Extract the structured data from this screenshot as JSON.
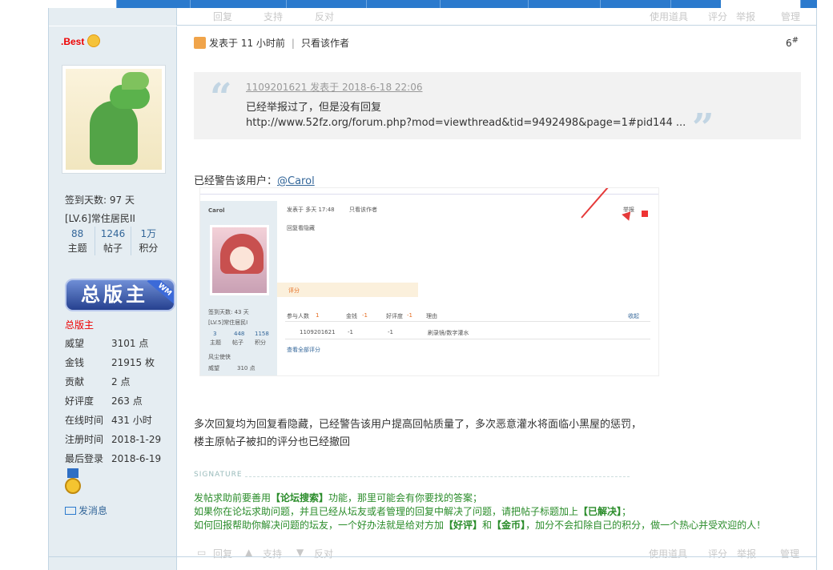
{
  "prev_actions": {
    "reply": "回复",
    "support": "支持",
    "oppose": "反对",
    "use_tool": "使用道具",
    "rate": "评分",
    "report": "举报",
    "manage": "管理"
  },
  "author": {
    "name": ".Best",
    "checkin_days": "签到天数: 97 天",
    "level": "[LV.6]常住居民II",
    "stats": [
      {
        "value": "88",
        "label": "主题"
      },
      {
        "value": "1246",
        "label": "帖子"
      },
      {
        "value": "1万",
        "label": "积分"
      }
    ],
    "badge_text": "总版主",
    "badge_tag": "WM",
    "group": "总版主",
    "details": [
      {
        "key": "威望",
        "value": "3101 点"
      },
      {
        "key": "金钱",
        "value": "21915 枚"
      },
      {
        "key": "贡献",
        "value": "2 点"
      },
      {
        "key": "好评度",
        "value": "263 点"
      },
      {
        "key": "在线时间",
        "value": "431 小时"
      },
      {
        "key": "注册时间",
        "value": "2018-1-29"
      },
      {
        "key": "最后登录",
        "value": "2018-6-19"
      }
    ],
    "send_message": "发消息"
  },
  "post": {
    "posted": "发表于 11 小时前",
    "only_author": "只看该作者",
    "floor": "6",
    "floor_suffix": "#",
    "quote": {
      "header": "1109201621 发表于 2018-6-18 22:06",
      "line1": "已经举报过了，但是没有回复",
      "line2": "http://www.52fz.org/forum.php?mod=viewthread&tid=9492498&page=1#pid144 ..."
    },
    "warned_prefix": "已经警告该用户：",
    "warned_user": "@Carol",
    "body_line1": "多次回复均为回复看隐藏，已经警告该用户提高回帖质量了，多次恶意灌水将面临小黑屋的惩罚，",
    "body_line2": "楼主原帖子被扣的评分也已经撤回"
  },
  "embedded_shot": {
    "user": "Carol",
    "posted": "发表于 多天 17:48",
    "only_author": "只看该作者",
    "report": "举报",
    "content": "回复看隐藏",
    "rate": "评分",
    "checkin": "签到天数: 43 天",
    "level": "[LV.5]常住居民I",
    "stats": [
      {
        "value": "3",
        "label": "主题"
      },
      {
        "value": "448",
        "label": "帖子"
      },
      {
        "value": "1158",
        "label": "积分"
      }
    ],
    "group": "风尘使侠",
    "weiwang": "威望",
    "weiwang_val": "310 点",
    "rate_table_headers": [
      "参与人数",
      "金钱",
      "好评度",
      "理由"
    ],
    "rate_count": "1",
    "rate_money": "-1",
    "rate_good": "-1",
    "collapse": "收起",
    "rater": "1109201621",
    "rater_money": "-1",
    "rater_good": "-1",
    "rater_reason": "刷录镜/数字灌水",
    "view_all": "查看全部评分"
  },
  "signature": {
    "label": "SIGNATURE",
    "line1_a": "发帖求助前要善用",
    "line1_b": "【论坛搜索】",
    "line1_c": "功能，那里可能会有你要找的答案；",
    "line2_a": "如果你在论坛求助问题，并且已经从坛友或者管理的回复中解决了问题，请把帖子标题加上",
    "line2_b": "【已解决】",
    "line2_c": "；",
    "line3_a": "如何回报帮助你解决问题的坛友，一个好办法就是给对方加",
    "line3_b": "【好评】",
    "line3_c": "和",
    "line3_d": "【金币】",
    "line3_e": "，加分不会扣除自己的积分，做一个热心并受欢迎的人！"
  },
  "actions": {
    "reply": "回复",
    "support": "支持",
    "oppose": "反对",
    "use_tool": "使用道具",
    "rate": "评分",
    "report": "举报",
    "manage": "管理"
  }
}
